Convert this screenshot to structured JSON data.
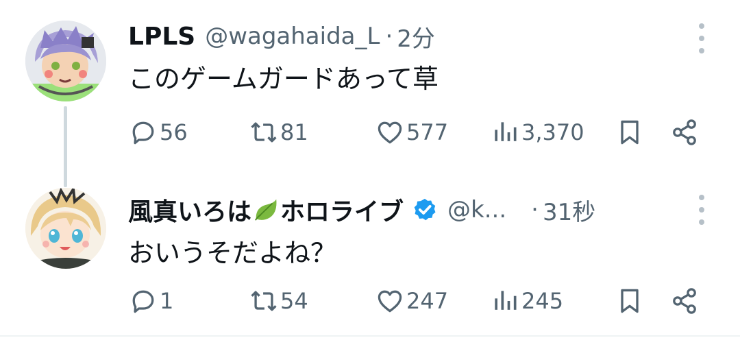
{
  "tweets": [
    {
      "display_name": "LPLS",
      "handle": "@wagahaida_L",
      "separator": "·",
      "time": "2分",
      "text": "このゲームガードあって草",
      "stats": {
        "replies": "56",
        "retweets": "81",
        "likes": "577",
        "views": "3,370"
      }
    },
    {
      "display_name_part1": "風真いろは",
      "display_name_part2": "ホロライブ",
      "verified": true,
      "handle": "@k...",
      "separator": "·",
      "time": "31秒",
      "text": "おいうそだよね？",
      "stats": {
        "replies": "1",
        "retweets": "54",
        "likes": "247",
        "views": "245"
      }
    }
  ],
  "icons": {
    "reply": "speech-bubble-icon",
    "retweet": "retweet-arrows-icon",
    "like": "heart-icon",
    "views": "bar-chart-icon",
    "bookmark": "bookmark-icon",
    "share": "share-nodes-icon",
    "more": "vertical-ellipsis-icon",
    "verified": "verified-badge-icon",
    "emoji": "leaf-emoji"
  },
  "colors": {
    "text": "#0f1419",
    "secondary": "#536471",
    "verified": "#1d9bf0",
    "thread_line": "#cfd9de"
  }
}
